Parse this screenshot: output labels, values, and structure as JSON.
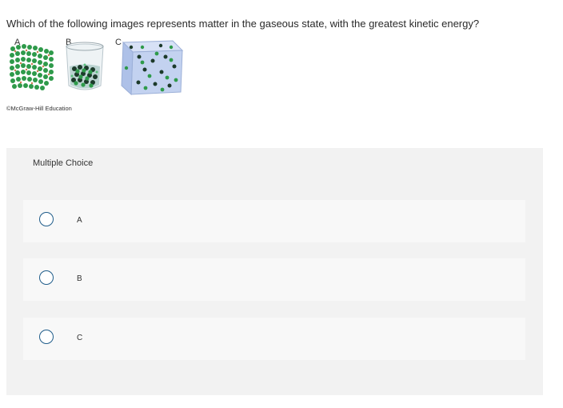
{
  "question": {
    "text": "Which of the following images represents matter in the gaseous state, with the greatest kinetic energy?"
  },
  "figure": {
    "labels": [
      "A",
      "B",
      "C"
    ],
    "credit": "©McGraw-Hill Education"
  },
  "multiple_choice": {
    "header": "Multiple Choice",
    "options": [
      {
        "label": "A",
        "selected": false
      },
      {
        "label": "B",
        "selected": false
      },
      {
        "label": "C",
        "selected": false
      }
    ]
  },
  "colors": {
    "radio_border": "#1f5c8a",
    "panel_bg": "#f2f2f2",
    "option_bg": "#f8f8f8",
    "particle_green": "#2e9a4a",
    "particle_dark": "#1c3a2a"
  }
}
